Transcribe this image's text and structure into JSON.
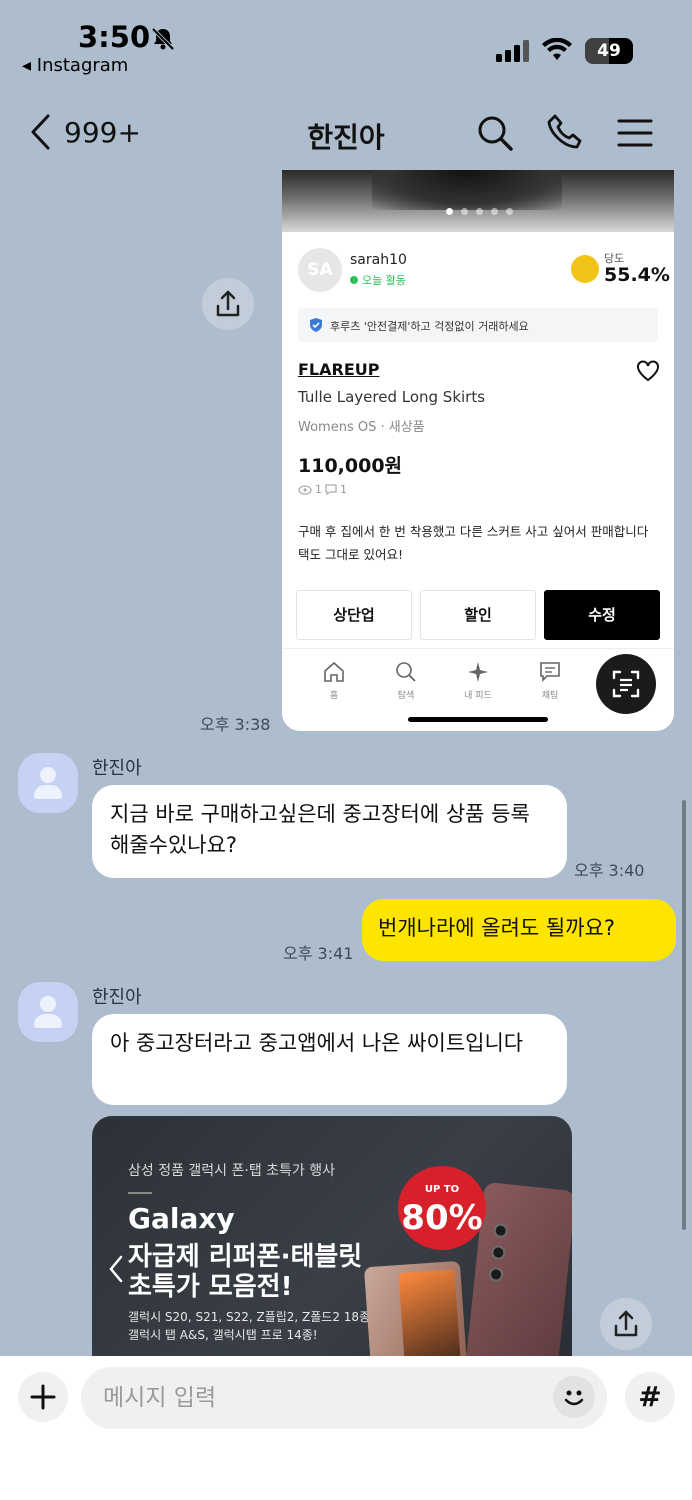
{
  "status_bar": {
    "time": "3:50",
    "back_app": "◂ Instagram",
    "battery": "49",
    "battery_level": 0.49
  },
  "header": {
    "unread_count": "999+",
    "title": "한진아"
  },
  "shared_post": {
    "seller": {
      "avatar_initials": "SA",
      "name": "sarah10",
      "activity": "오늘 활동"
    },
    "sweetness_label": "당도",
    "sweetness_value": "55.4%",
    "safe_notice": "후루츠 '안전결제'하고 걱정없이 거래하세요",
    "brand": "FLAREUP",
    "product_name": "Tulle Layered Long Skirts",
    "category": "Womens OS · 새상품",
    "price": "110,000원",
    "views": "1",
    "comments": "1",
    "description": "구매 후 집에서 한 번 착용했고 다른 스커트 사고 싶어서 판매합니다 택도 그대로 있어요!",
    "buttons": {
      "bump": "상단업",
      "discount": "할인",
      "edit": "수정"
    },
    "bottom_nav": {
      "home": "홈",
      "search": "탐색",
      "feed": "내 피드",
      "chat": "채팅"
    },
    "image_dots": 5,
    "active_dot": 1
  },
  "messages": [
    {
      "time": "오후 3:38"
    },
    {
      "sender": "한진아",
      "text": "지금 바로 구매하고싶은데 중고장터에 상품 등록해줄수있나요?",
      "time": "오후 3:40"
    },
    {
      "text": "번개나라에 올려도 될까요?",
      "time": "오후 3:41"
    },
    {
      "sender": "한진아",
      "text": "아 중고장터라고 중고앱에서 나온 싸이트입니다"
    }
  ],
  "promo": {
    "subtitle": "삼성 정품 갤럭시 폰·탭 초특가 행사",
    "brand": "Galaxy",
    "headline_1": "자급제 리퍼폰·태블릿",
    "headline_2": "초특가 모음전!",
    "detail_1": "갤럭시 S20, S21, S22, Z플립2, Z폴드2 18종!",
    "detail_2": "갤럭시 탭 A&S, 갤럭시탭 프로 14종!",
    "badge_upto": "UP TO",
    "badge_pct": "80%"
  },
  "input": {
    "placeholder": "메시지 입력",
    "hash": "#"
  },
  "colors": {
    "chat_bg": "#aebdcd",
    "my_bubble": "#fee500",
    "their_bubble": "#ffffff",
    "promo_badge": "#d8202a"
  }
}
